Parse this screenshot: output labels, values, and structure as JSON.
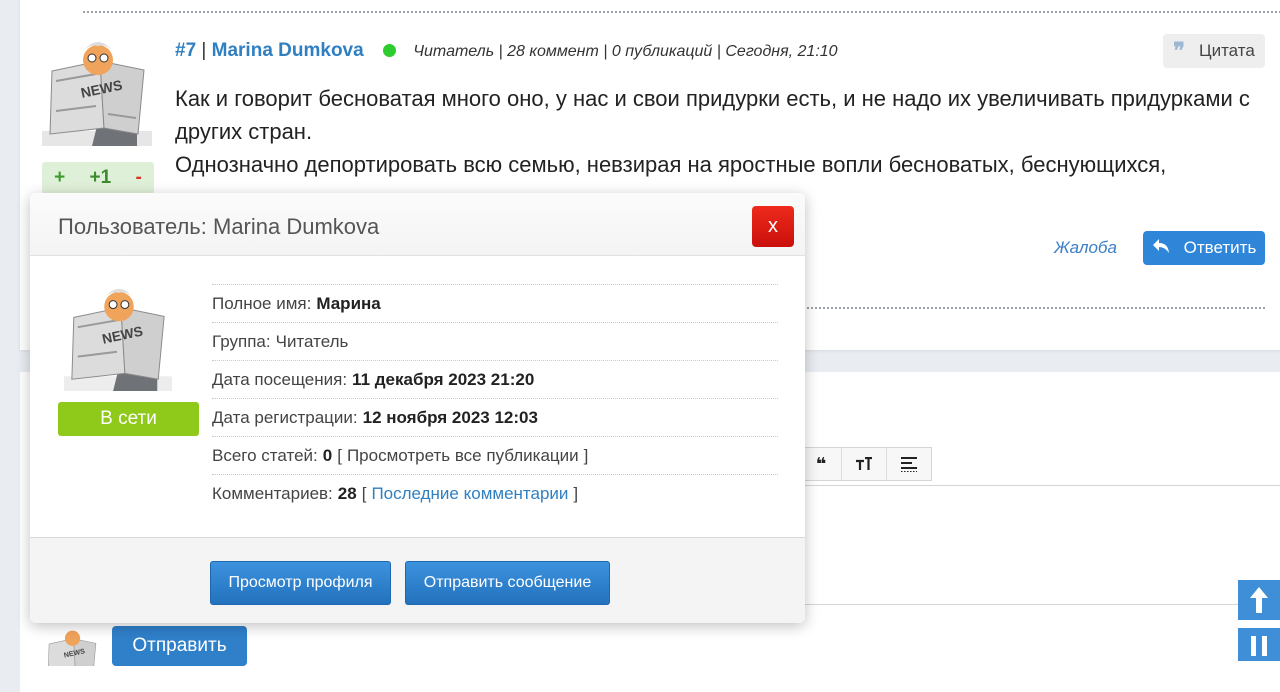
{
  "comment": {
    "number": "#7",
    "separator": "|",
    "author": "Marina Dumkova",
    "meta": "Читатель | 28 коммент | 0 публикаций | Сегодня, 21:10",
    "quote_label": "Цитата",
    "rating": {
      "plus": "+",
      "value": "+1",
      "minus": "-"
    },
    "text_lines": [
      "Как и говорит бесноватая много оно, у нас и свои придурки есть, и не надо их увеличивать придурками с других стран.",
      "Однозначно депортировать всю семью, невзирая на яростные вопли бесноватых, беснующихся,"
    ],
    "complaint_label": "Жалоба",
    "reply_label": "Ответить"
  },
  "modal": {
    "title": "Пользователь: Marina Dumkova",
    "close_label": "x",
    "status": "В сети",
    "fields": {
      "full_name_label": "Полное имя:",
      "full_name_value": "Марина",
      "group_label": "Группа:",
      "group_value": "Читатель",
      "visit_label": "Дата посещения:",
      "visit_value": "11 декабря 2023 21:20",
      "reg_label": "Дата регистрации:",
      "reg_value": "12 ноября 2023 12:03",
      "articles_label": "Всего статей:",
      "articles_value": "0",
      "articles_link": "Просмотреть все публикации",
      "comments_label": "Комментариев:",
      "comments_value": "28",
      "comments_link": "Последние комментарии",
      "bracket_open": "[",
      "bracket_close": "]"
    },
    "view_profile_label": "Просмотр профиля",
    "send_message_label": "Отправить сообщение"
  },
  "reply_form": {
    "send_label": "Отправить"
  },
  "avatar_text": "NEWS",
  "icons": [
    "quote-icon",
    "reply-icon",
    "blockquote-icon",
    "text-size-icon",
    "align-icon",
    "scroll-up-icon",
    "pause-icon"
  ],
  "colors": {
    "link": "#2f7fc1",
    "online": "#8fc91a",
    "online_dot": "#2ecc2e",
    "close": "#e11d14",
    "button": "#2f7fc9"
  }
}
